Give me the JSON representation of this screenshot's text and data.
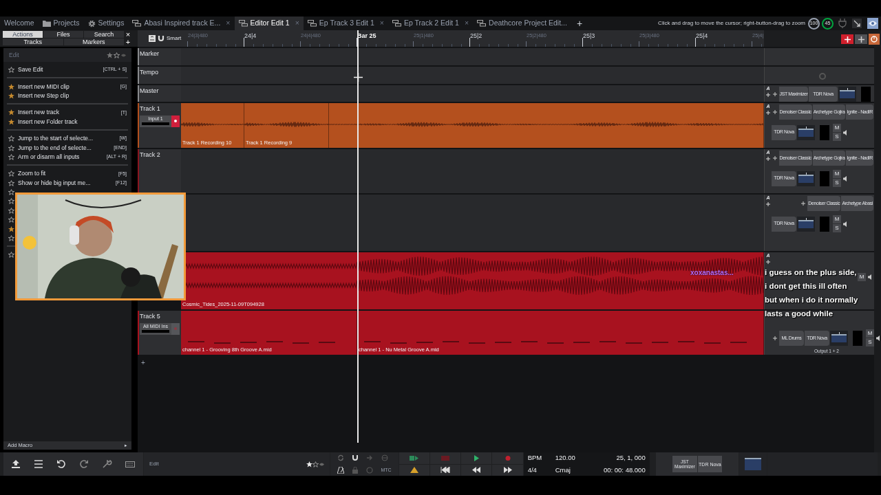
{
  "tabs": [
    {
      "kind": "text",
      "label": "Welcome",
      "selected": false
    },
    {
      "kind": "folder",
      "label": "Projects",
      "selected": false
    },
    {
      "kind": "gear",
      "label": "Settings",
      "selected": false
    },
    {
      "kind": "edit",
      "label": "Abasi Inspired track E...",
      "selected": false,
      "close": "×"
    },
    {
      "kind": "edit",
      "label": "Editor Edit 1",
      "selected": true,
      "close": "×"
    },
    {
      "kind": "edit",
      "label": "Ep Track 3 Edit 1",
      "selected": false,
      "close": "×"
    },
    {
      "kind": "edit",
      "label": "Ep Track 2 Edit 1",
      "selected": false,
      "close": "×"
    },
    {
      "kind": "edit",
      "label": "Deathcore Project Edit...",
      "selected": false
    }
  ],
  "new_tab": "+",
  "status_hint": "Click and drag to move the cursor; right-button-drag to zoom",
  "meters": [
    "100",
    "45"
  ],
  "browser": {
    "tabs": [
      {
        "label": "Actions",
        "selected": true
      },
      {
        "label": "Files",
        "selected": false
      },
      {
        "label": "Search",
        "selected": false
      },
      {
        "label": "Tracks",
        "selected": false
      },
      {
        "label": "Markers",
        "selected": false
      }
    ],
    "close": "×",
    "add": "+",
    "section": "Edit",
    "groups": [
      [
        {
          "label": "Save Edit",
          "shortcut": "[CTRL + S]",
          "favorite": false
        }
      ],
      [
        {
          "label": "Insert new MIDI clip",
          "shortcut": "[G]",
          "favorite": true
        },
        {
          "label": "Insert new Step clip",
          "favorite": true
        }
      ],
      [
        {
          "label": "Insert new track",
          "shortcut": "[T]",
          "favorite": true
        },
        {
          "label": "Insert new Folder track",
          "favorite": true
        }
      ],
      [
        {
          "label": "Jump to the start of selecte...",
          "shortcut": "[W]",
          "favorite": false
        },
        {
          "label": "Jump to the end of selecte...",
          "shortcut": "[END]",
          "favorite": false
        },
        {
          "label": "Arm or disarm all inputs",
          "shortcut": "[ALT + R]",
          "favorite": false
        }
      ],
      [
        {
          "label": "Zoom to fit",
          "shortcut": "[F5]",
          "favorite": false
        },
        {
          "label": "Show or hide big input me...",
          "shortcut": "[F12]",
          "favorite": false
        },
        {
          "favorite": false
        },
        {
          "favorite": false
        },
        {
          "favorite": false
        },
        {
          "favorite": false
        },
        {
          "favorite": true
        },
        {
          "favorite": false
        }
      ],
      [
        {
          "favorite": false
        }
      ]
    ],
    "footer": "Add Macro",
    "footer_arrow": "▸"
  },
  "ruler": {
    "mode": "Smart",
    "ticks": [
      {
        "label": "24|3|480",
        "kind": "minor"
      },
      {
        "label": "24|4",
        "kind": "major"
      },
      {
        "label": "24|4|480",
        "kind": "minor"
      },
      {
        "label": "Bar 25",
        "kind": "bar"
      },
      {
        "label": "25|1|480",
        "kind": "minor"
      },
      {
        "label": "25|2",
        "kind": "major"
      },
      {
        "label": "25|2|480",
        "kind": "minor"
      },
      {
        "label": "25|3",
        "kind": "major"
      },
      {
        "label": "25|3|480",
        "kind": "minor"
      },
      {
        "label": "25|4",
        "kind": "major"
      },
      {
        "label": "25|4|",
        "kind": "minor"
      }
    ]
  },
  "tracks": [
    {
      "kind": "marker",
      "name": "Marker"
    },
    {
      "kind": "tempo",
      "name": "Tempo"
    },
    {
      "kind": "master",
      "name": "Master",
      "automation": "A",
      "strip": [
        "JST Maximizer",
        "TDR Nova"
      ]
    },
    {
      "kind": "audio",
      "name": "Track 1",
      "color": "#b4501e",
      "input": "Input 1",
      "armed": true,
      "automation": "A",
      "clips": [
        {
          "kind": "mono",
          "label": "Track 1 Recording 10"
        },
        {
          "kind": "mono",
          "label": "Track 1 Recording 9"
        },
        {
          "kind": "mono"
        }
      ],
      "chain": [
        "Denoiser Classic",
        "Archetype Gojira",
        "Ignite - NadIR"
      ],
      "strip": [
        "TDR Nova"
      ],
      "mute": "M",
      "solo": "S"
    },
    {
      "kind": "audio",
      "name": "Track 2",
      "color": "#8a1620",
      "automation": "A",
      "chain": [
        "Denoiser Classic",
        "Archetype Gojira",
        "Ignite - NadIR"
      ],
      "strip": [
        "TDR Nova"
      ],
      "mute": "M",
      "solo": "S"
    },
    {
      "kind": "audio",
      "automation": "A",
      "chain": [
        "Denoiser Classic",
        "Archetype Abasi"
      ],
      "strip": [
        "TDR Nova"
      ],
      "mute": "M",
      "solo": "S"
    },
    {
      "kind": "audio",
      "color": "#a8121f",
      "automation": "A",
      "clips": [
        {
          "kind": "stereo",
          "label": "Cosmic_Tides_2025-11-09T094928"
        }
      ],
      "mute": "M"
    },
    {
      "kind": "midi",
      "name": "Track 5",
      "color": "#a8121f",
      "input": "All MIDI Ins",
      "armed": false,
      "clips": [
        {
          "kind": "midi",
          "label": "channel 1 - Grooving 8th Groove A.mid"
        },
        {
          "kind": "midi",
          "label": "channel 1 - Nu Metal Groove A.mid"
        }
      ],
      "strip": [
        "ML Drums",
        "TDR Nova"
      ],
      "mute": "M",
      "solo": "S",
      "output": "Output 1 + 2"
    }
  ],
  "add_track": "+",
  "chat": {
    "user": "xoxanastas...",
    "message": "i guess on the plus side, i dont get this ill often but when i do it normally lasts a good while"
  },
  "transport": {
    "edit_field": "Edit",
    "mtc": "MTC",
    "bpm_label": "BPM",
    "bpm": "120.00",
    "position": "25, 1, 000",
    "time_sig": "4/4",
    "key": "Cmaj",
    "time": "00: 00: 48.000",
    "plugins": [
      "JST Maximizer",
      "TDR Nova"
    ]
  }
}
